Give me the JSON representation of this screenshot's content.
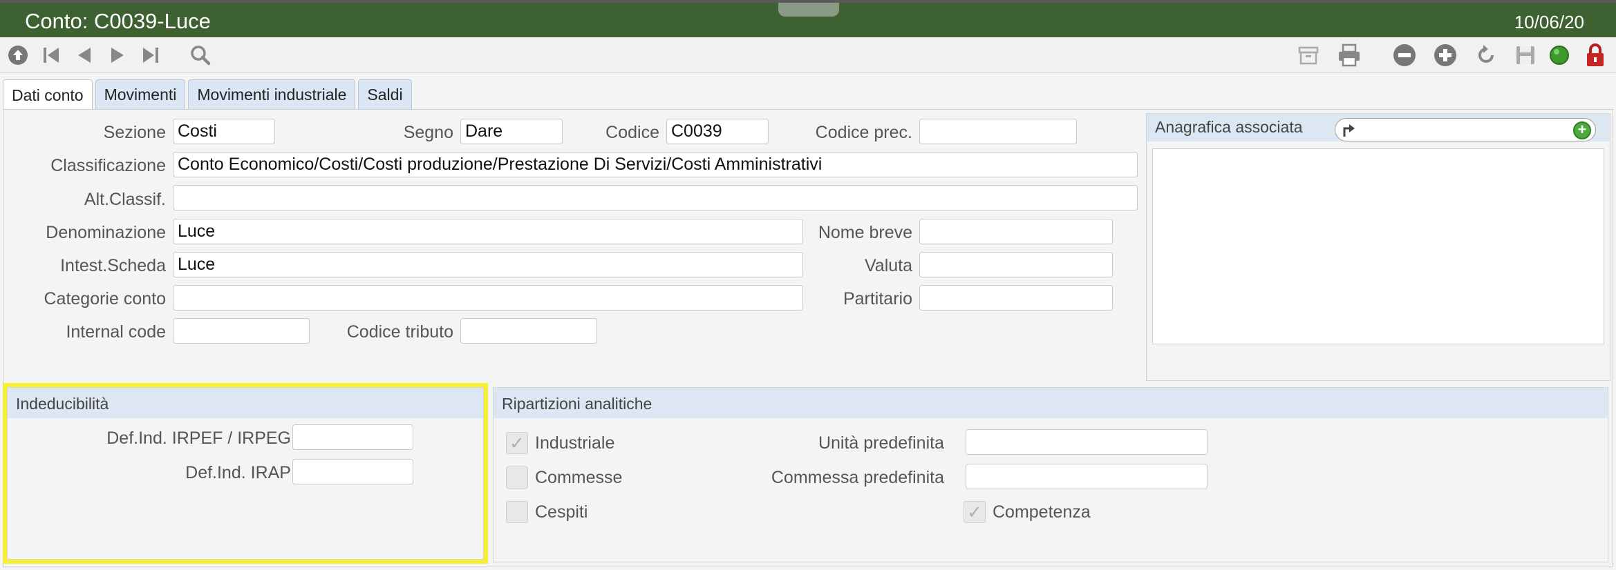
{
  "window": {
    "title": "Conto: C0039-Luce",
    "date": "10/06/20"
  },
  "toolbar": {
    "left_icons": [
      "home-up-icon",
      "first-record-icon",
      "previous-record-icon",
      "next-record-icon",
      "last-record-icon",
      "search-icon"
    ],
    "right_icons": [
      "archive-icon",
      "print-icon",
      "delete-icon",
      "add-icon",
      "refresh-icon",
      "save-icon",
      "status-green-icon",
      "lock-icon"
    ]
  },
  "tabs": [
    {
      "label": "Dati conto",
      "active": true
    },
    {
      "label": "Movimenti",
      "active": false
    },
    {
      "label": "Movimenti industriale",
      "active": false
    },
    {
      "label": "Saldi",
      "active": false
    }
  ],
  "form": {
    "sezione": {
      "label": "Sezione",
      "value": "Costi"
    },
    "segno": {
      "label": "Segno",
      "value": "Dare"
    },
    "codice": {
      "label": "Codice",
      "value": "C0039"
    },
    "codice_prec": {
      "label": "Codice prec.",
      "value": ""
    },
    "classificazione": {
      "label": "Classificazione",
      "value": "Conto Economico/Costi/Costi produzione/Prestazione Di Servizi/Costi Amministrativi"
    },
    "alt_classif": {
      "label": "Alt.Classif.",
      "value": ""
    },
    "denominazione": {
      "label": "Denominazione",
      "value": "Luce"
    },
    "nome_breve": {
      "label": "Nome breve",
      "value": ""
    },
    "intest_scheda": {
      "label": "Intest.Scheda",
      "value": "Luce"
    },
    "valuta": {
      "label": "Valuta",
      "value": ""
    },
    "categorie_conto": {
      "label": "Categorie conto",
      "value": ""
    },
    "partitario": {
      "label": "Partitario",
      "value": ""
    },
    "internal_code": {
      "label": "Internal code",
      "value": ""
    },
    "codice_tributo": {
      "label": "Codice tributo",
      "value": ""
    }
  },
  "anagrafica": {
    "title": "Anagrafica associata",
    "value": ""
  },
  "indeducibilita": {
    "title": "Indeducibilità",
    "irpef": {
      "label": "Def.Ind. IRPEF / IRPEG",
      "value": ""
    },
    "irap": {
      "label": "Def.Ind. IRAP",
      "value": ""
    }
  },
  "ripartizioni": {
    "title": "Ripartizioni analitiche",
    "industriale": {
      "label": "Industriale",
      "checked": true
    },
    "commesse": {
      "label": "Commesse",
      "checked": false
    },
    "cespiti": {
      "label": "Cespiti",
      "checked": false
    },
    "unita_predefinita": {
      "label": "Unità predefinita",
      "value": ""
    },
    "commessa_predefinita": {
      "label": "Commessa predefinita",
      "value": ""
    },
    "competenza": {
      "label": "Competenza",
      "checked": true
    }
  },
  "colors": {
    "title_bar": "#3d6130",
    "section_header": "#dde7f4",
    "highlight": "#f7f032"
  }
}
